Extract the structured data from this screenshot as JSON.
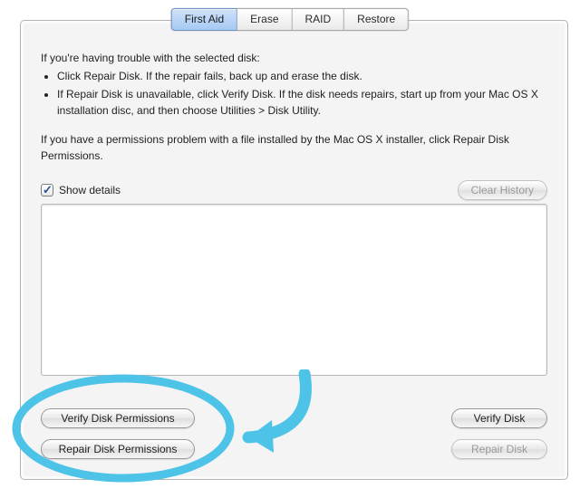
{
  "tabs": {
    "first_aid": "First Aid",
    "erase": "Erase",
    "raid": "RAID",
    "restore": "Restore"
  },
  "intro": {
    "lead": "If you're having trouble with the selected disk:",
    "bullet1": "Click Repair Disk. If the repair fails, back up and erase the disk.",
    "bullet2": "If Repair Disk is unavailable, click Verify Disk. If the disk needs repairs, start up from your Mac OS X installation disc, and then choose Utilities > Disk Utility.",
    "perm": "If you have a permissions problem with a file installed by the Mac OS X installer, click Repair Disk Permissions."
  },
  "details": {
    "show_details": "Show details",
    "clear_history": "Clear History"
  },
  "buttons": {
    "verify_disk_permissions": "Verify Disk Permissions",
    "repair_disk_permissions": "Repair Disk Permissions",
    "verify_disk": "Verify Disk",
    "repair_disk": "Repair Disk"
  }
}
